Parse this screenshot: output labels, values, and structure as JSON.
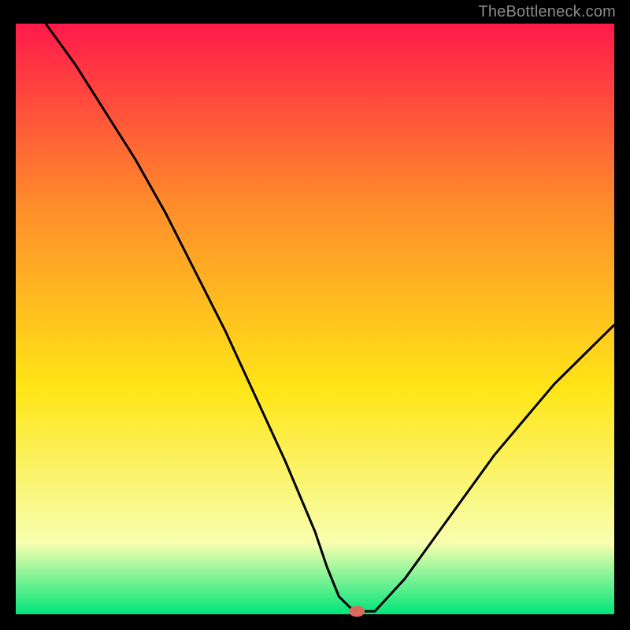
{
  "attribution": "TheBottleneck.com",
  "chart_data": {
    "type": "line",
    "title": "",
    "xlabel": "",
    "ylabel": "",
    "xlim": [
      0,
      100
    ],
    "ylim": [
      0,
      100
    ],
    "series": [
      {
        "name": "bottleneck-curve",
        "x": [
          5,
          10,
          15,
          20,
          25,
          30,
          35,
          40,
          45,
          50,
          52,
          54,
          56,
          57,
          60,
          65,
          70,
          75,
          80,
          85,
          90,
          95,
          100
        ],
        "y": [
          100,
          93,
          85,
          77,
          68,
          58,
          48,
          37,
          26,
          14,
          8,
          3,
          1,
          0.5,
          0.5,
          6,
          13,
          20,
          27,
          33,
          39,
          44,
          49
        ]
      }
    ],
    "marker": {
      "name": "optimal-point",
      "x": 57,
      "y": 0.5,
      "color": "#d86b5e"
    },
    "background_gradient": {
      "top": "#ff1a4a",
      "mid1": "#ff8a2b",
      "mid2": "#ffe617",
      "low": "#f7ffb0",
      "bottom": "#00e57a"
    }
  }
}
